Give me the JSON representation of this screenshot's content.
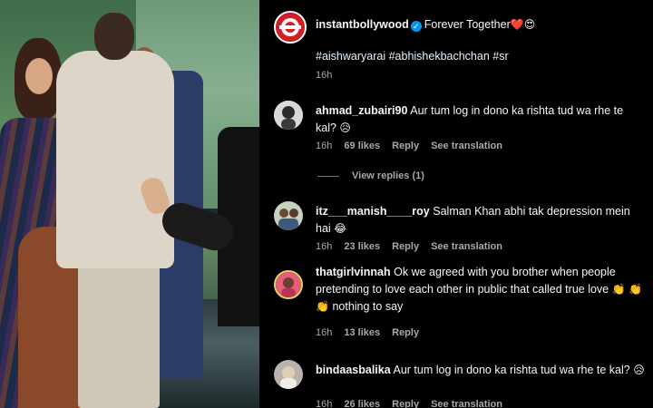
{
  "post": {
    "username": "instantbollywood",
    "caption": "Forever Together",
    "caption_emojis": "❤️😍",
    "hashtags": "#aishwaryarai #abhishekbachchan #sr",
    "time": "16h"
  },
  "comments": [
    {
      "username": "ahmad_zubairi90",
      "text": "Aur tum log in dono ka rishta tud wa rhe te kal?",
      "emoji": "😥",
      "time": "16h",
      "likes": "69 likes",
      "reply": "Reply",
      "translate": "See translation",
      "view_replies": "View replies (1)"
    },
    {
      "username": "itz___manish____roy",
      "text": "Salman Khan abhi tak depression mein hai",
      "emoji": "😂",
      "time": "16h",
      "likes": "23 likes",
      "reply": "Reply",
      "translate": "See translation"
    },
    {
      "username": "thatgirlvinnah",
      "text": "Ok we agreed with you brother when people pretending to love each other in public that called true love",
      "emoji": "👏 👏 👏",
      "text_after": "nothing to say",
      "time": "16h",
      "likes": "13 likes",
      "reply": "Reply"
    },
    {
      "username": "bindaasbalika",
      "text": "Aur tum log in dono ka rishta tud wa rhe te kal?",
      "emoji": "😥",
      "time": "16h",
      "likes": "26 likes",
      "reply": "Reply",
      "translate": "See translation"
    }
  ],
  "colors": {
    "background": "#000000",
    "text": "#f5f5f5",
    "muted": "#a8a8a8",
    "verified": "#0095f6",
    "hashtag": "#e0f1ff"
  },
  "icons": [
    "verified-badge-icon"
  ]
}
